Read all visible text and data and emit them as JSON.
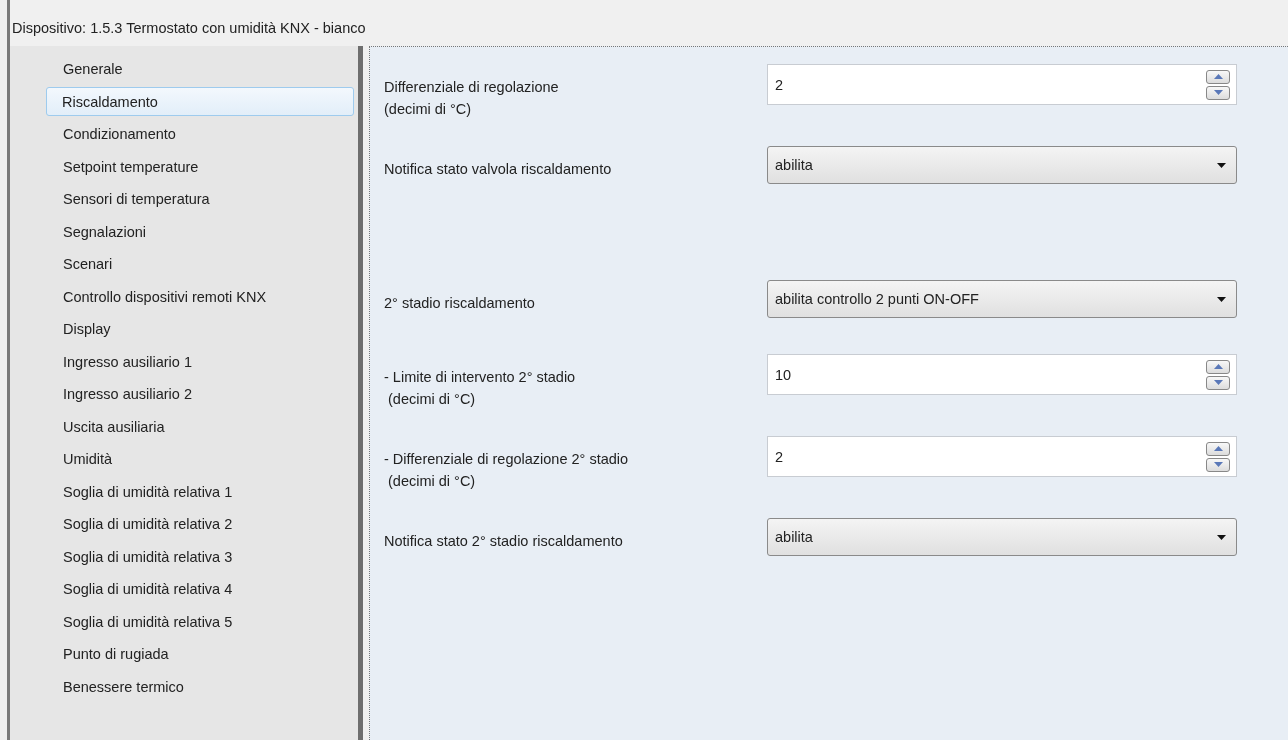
{
  "window": {
    "title": "Dispositivo: 1.5.3  Termostato con umidità KNX - bianco"
  },
  "sidebar": {
    "items": [
      {
        "label": "Generale",
        "selected": false
      },
      {
        "label": "Riscaldamento",
        "selected": true
      },
      {
        "label": "Condizionamento",
        "selected": false
      },
      {
        "label": "Setpoint temperature",
        "selected": false
      },
      {
        "label": "Sensori di temperatura",
        "selected": false
      },
      {
        "label": "Segnalazioni",
        "selected": false
      },
      {
        "label": "Scenari",
        "selected": false
      },
      {
        "label": "Controllo dispositivi remoti KNX",
        "selected": false
      },
      {
        "label": "Display",
        "selected": false
      },
      {
        "label": "Ingresso ausiliario 1",
        "selected": false
      },
      {
        "label": "Ingresso ausiliario 2",
        "selected": false
      },
      {
        "label": "Uscita ausiliaria",
        "selected": false
      },
      {
        "label": "Umidità",
        "selected": false
      },
      {
        "label": "Soglia di umidità relativa 1",
        "selected": false
      },
      {
        "label": "Soglia di umidità relativa 2",
        "selected": false
      },
      {
        "label": "Soglia di umidità relativa 3",
        "selected": false
      },
      {
        "label": "Soglia di umidità relativa 4",
        "selected": false
      },
      {
        "label": "Soglia di umidità relativa 5",
        "selected": false
      },
      {
        "label": "Punto di rugiada",
        "selected": false
      },
      {
        "label": "Benessere termico",
        "selected": false
      }
    ]
  },
  "parameter_groups": [
    [
      {
        "kind": "spin",
        "label_lines": [
          "Differenziale di regolazione",
          "(decimi di °C)"
        ],
        "value": "2"
      },
      {
        "kind": "select",
        "label_lines": [
          "Notifica stato valvola riscaldamento"
        ],
        "value": "abilita"
      }
    ],
    [
      {
        "kind": "select",
        "label_lines": [
          "2° stadio riscaldamento"
        ],
        "value": "abilita controllo 2 punti ON-OFF"
      },
      {
        "kind": "spin",
        "label_lines": [
          "- Limite di intervento 2° stadio",
          " (decimi di °C)"
        ],
        "value": "10"
      },
      {
        "kind": "spin",
        "label_lines": [
          "- Differenziale di regolazione 2° stadio",
          " (decimi di °C)"
        ],
        "value": "2"
      },
      {
        "kind": "select",
        "label_lines": [
          "Notifica stato 2° stadio riscaldamento"
        ],
        "value": "abilita"
      }
    ]
  ]
}
